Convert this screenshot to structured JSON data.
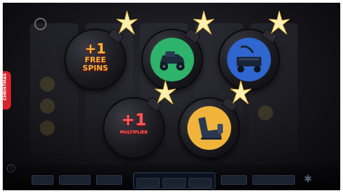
{
  "side_tab": {
    "label": "CHRISTMAS"
  },
  "bombs": [
    {
      "id": "free-spins",
      "prize_line1": "+1",
      "prize_line2": "FREE",
      "prize_line3": "SPINS",
      "revealed": "text"
    },
    {
      "id": "green-car",
      "icon": "rc-car-icon",
      "disc_color": "#2db36a",
      "revealed": "icon"
    },
    {
      "id": "blue-wagon",
      "icon": "wagon-icon",
      "disc_color": "#2f66cf",
      "revealed": "icon"
    },
    {
      "id": "multiplier",
      "prize_line1": "+1",
      "prize_line2": "MULTIPLIER",
      "revealed": "text"
    },
    {
      "id": "yellow-chair",
      "icon": "armchair-icon",
      "disc_color": "#f0b43a",
      "revealed": "icon"
    }
  ],
  "colors": {
    "prize_text": "#ff5a5a",
    "prize_gold": "#f4b63a",
    "spark": "#fff2b0"
  }
}
